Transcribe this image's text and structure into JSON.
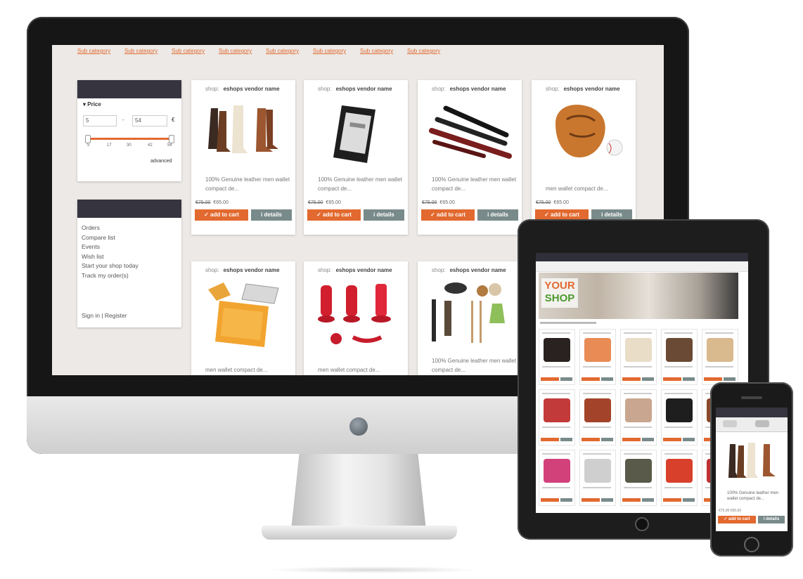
{
  "subnav": [
    "Sub category",
    "Sub category",
    "Sub category",
    "Sub category",
    "Sub category",
    "Sub category",
    "Sub category",
    "Sub category"
  ],
  "price_filter": {
    "label": "Price",
    "min_value": "5",
    "max_value": "54",
    "currency": "€",
    "separator": "-",
    "ticks": [
      "5",
      "17",
      "30",
      "42",
      "54"
    ],
    "advanced_label": "advanced"
  },
  "account_menu": {
    "items": [
      "Orders",
      "Compare list",
      "Events",
      "Wish list",
      "Start your shop today",
      "Track my order(s)"
    ],
    "signin": "Sign in | Register"
  },
  "products": [
    {
      "shop_label": "shop:",
      "vendor": "eshops vendor name",
      "title": "100% Genuine leather men wallet compact de...",
      "old_price": "€75.00",
      "price": "€65.00",
      "image": "boots"
    },
    {
      "shop_label": "shop:",
      "vendor": "eshops vendor name",
      "title": "100% Genuine leather men wallet compact de...",
      "old_price": "€75.00",
      "price": "€65.00",
      "image": "ereader"
    },
    {
      "shop_label": "shop:",
      "vendor": "eshops vendor name",
      "title": "100% Genuine leather men wallet compact de...",
      "old_price": "€75.00",
      "price": "€65.00",
      "image": "pens"
    },
    {
      "shop_label": "shop:",
      "vendor": "eshops vendor name",
      "title": "men wallet compact de...",
      "old_price": "€75.00",
      "price": "€65.00",
      "image": "baseball-glove"
    },
    {
      "shop_label": "shop:",
      "vendor": "eshops vendor name",
      "title": "men wallet compact de...",
      "image": "tablet-case"
    },
    {
      "shop_label": "shop:",
      "vendor": "eshops vendor name",
      "title": "men wallet compact de...",
      "image": "hair-dryers"
    },
    {
      "shop_label": "shop:",
      "vendor": "eshops vendor name",
      "title": "100% Genuine leather men wallet compact de...",
      "image": "accessories"
    }
  ],
  "buttons": {
    "add_to_cart": "✓ add to cart",
    "details": "i details"
  },
  "tablet": {
    "banner_word1": "YOUR",
    "banner_word2": "SHOP"
  },
  "phone": {
    "title": "100% Genuine leather men wallet compact de...",
    "price": "€75.00 €65.00",
    "add_to_cart": "✓ add to cart",
    "details": "i details"
  },
  "colors": {
    "accent": "#e2692f",
    "details": "#798a8a",
    "sidebar_head": "#35343f"
  }
}
